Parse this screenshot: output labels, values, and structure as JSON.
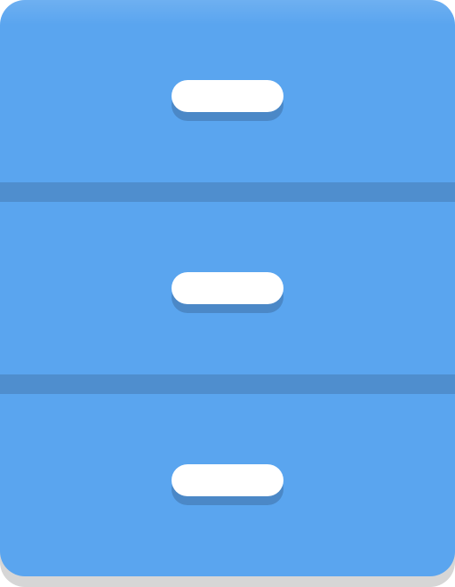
{
  "icon": {
    "name": "file-cabinet-icon",
    "colors": {
      "cabinet": "#5aa5ef",
      "divider": "#4f8ece",
      "handle": "#ffffff",
      "handle_shadow": "#4b88c7",
      "shadow": "#d6d6d6"
    },
    "drawers": [
      {
        "name": "drawer-top"
      },
      {
        "name": "drawer-middle"
      },
      {
        "name": "drawer-bottom"
      }
    ]
  }
}
